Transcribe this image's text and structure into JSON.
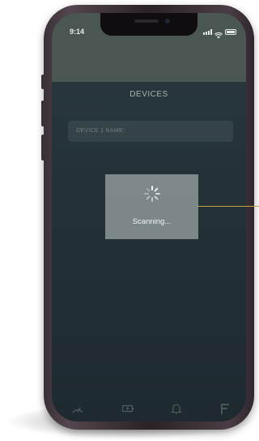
{
  "status_bar": {
    "time": "9:14"
  },
  "header": {
    "title": "DEVICES"
  },
  "device_field": {
    "placeholder": "DEVICE 1 NAME:"
  },
  "scan_dialog": {
    "message": "Scanning..."
  },
  "tab_bar": {
    "items": [
      {
        "icon": "gauge-icon"
      },
      {
        "icon": "battery-icon"
      },
      {
        "icon": "bell-icon"
      },
      {
        "icon": "flag-icon"
      }
    ]
  },
  "colors": {
    "screen_background": "#243238",
    "status_bar_background": "#4a5652",
    "dialog_background": "#96a0a2",
    "accent_callout": "#c9a544"
  }
}
